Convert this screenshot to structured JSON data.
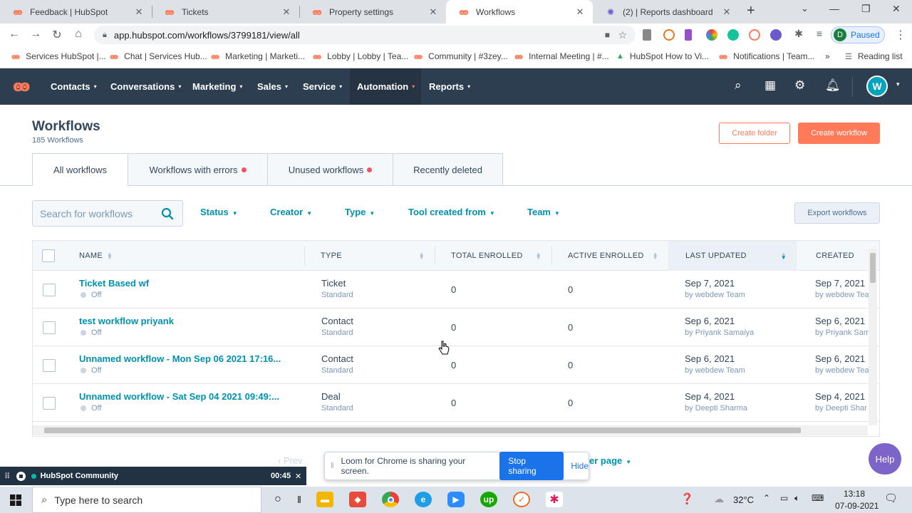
{
  "browser": {
    "tabs": [
      {
        "title": "Feedback | HubSpot",
        "icon": "hubspot-icon"
      },
      {
        "title": "Tickets",
        "icon": "hubspot-icon"
      },
      {
        "title": "Property settings",
        "icon": "hubspot-icon"
      },
      {
        "title": "Workflows",
        "icon": "hubspot-icon",
        "active": true
      },
      {
        "title": "(2) | Reports dashboard",
        "icon": "reports-icon"
      }
    ],
    "url": "app.hubspot.com/workflows/3799181/view/all",
    "profile_initial": "D",
    "profile_status": "Paused",
    "bookmarks": [
      "Services HubSpot |...",
      "Chat | Services Hub...",
      "Marketing | Marketi...",
      "Lobby | Lobby | Tea...",
      "Community | #3zey...",
      "Internal Meeting | #...",
      "HubSpot How to Vi...",
      "Notifications | Team..."
    ],
    "more_bookmarks": "»",
    "reading_list": "Reading list"
  },
  "nav": {
    "items": [
      "Contacts",
      "Conversations",
      "Marketing",
      "Sales",
      "Service",
      "Automation",
      "Reports"
    ],
    "active": "Automation",
    "avatar_letter": "W"
  },
  "page": {
    "title": "Workflows",
    "count": "185 Workflows",
    "create_folder": "Create folder",
    "create_workflow": "Create workflow",
    "tabs": [
      {
        "label": "All workflows",
        "dot": false
      },
      {
        "label": "Workflows with errors",
        "dot": true
      },
      {
        "label": "Unused workflows",
        "dot": true
      },
      {
        "label": "Recently deleted",
        "dot": false
      }
    ],
    "search_placeholder": "Search for workflows",
    "filters": [
      "Status",
      "Creator",
      "Type",
      "Tool created from",
      "Team"
    ],
    "export": "Export workflows"
  },
  "table": {
    "columns": [
      "NAME",
      "TYPE",
      "TOTAL ENROLLED",
      "ACTIVE ENROLLED",
      "LAST UPDATED",
      "CREATED"
    ],
    "sorted_column": "LAST UPDATED",
    "rows": [
      {
        "name": "Ticket Based wf",
        "status": "Off",
        "type": "Ticket",
        "subtype": "Standard",
        "total": "0",
        "active": "0",
        "updated": "Sep 7, 2021",
        "updated_by": "by webdew Team",
        "created": "Sep 7, 2021",
        "created_by": "by webdew Tea"
      },
      {
        "name": "test workflow priyank",
        "status": "Off",
        "type": "Contact",
        "subtype": "Standard",
        "total": "0",
        "active": "0",
        "updated": "Sep 6, 2021",
        "updated_by": "by Priyank Samaiya",
        "created": "Sep 6, 2021",
        "created_by": "by Priyank Sam"
      },
      {
        "name": "Unnamed workflow - Mon Sep 06 2021 17:16...",
        "status": "Off",
        "type": "Contact",
        "subtype": "Standard",
        "total": "0",
        "active": "0",
        "updated": "Sep 6, 2021",
        "updated_by": "by webdew Team",
        "created": "Sep 6, 2021",
        "created_by": "by webdew Tea"
      },
      {
        "name": "Unnamed workflow - Sat Sep 04 2021 09:49:...",
        "status": "Off",
        "type": "Deal",
        "subtype": "Standard",
        "total": "0",
        "active": "0",
        "updated": "Sep 4, 2021",
        "updated_by": "by Deepti Sharma",
        "created": "Sep 4, 2021",
        "created_by": "by Deepti Shar"
      }
    ]
  },
  "pagination": {
    "prev": "Prev",
    "per_page": "er page"
  },
  "loom": {
    "message": "Loom for Chrome is sharing your screen.",
    "stop": "Stop sharing",
    "hide": "Hide"
  },
  "help": "Help",
  "community": {
    "title": "HubSpot Community",
    "timer": "00:45"
  },
  "taskbar": {
    "search_placeholder": "Type here to search",
    "temperature": "32°C",
    "time": "13:18",
    "date": "07-09-2021"
  },
  "colors": {
    "accent": "#ff7a59",
    "nav_bg": "#2d3e50",
    "link": "#0091ae"
  }
}
